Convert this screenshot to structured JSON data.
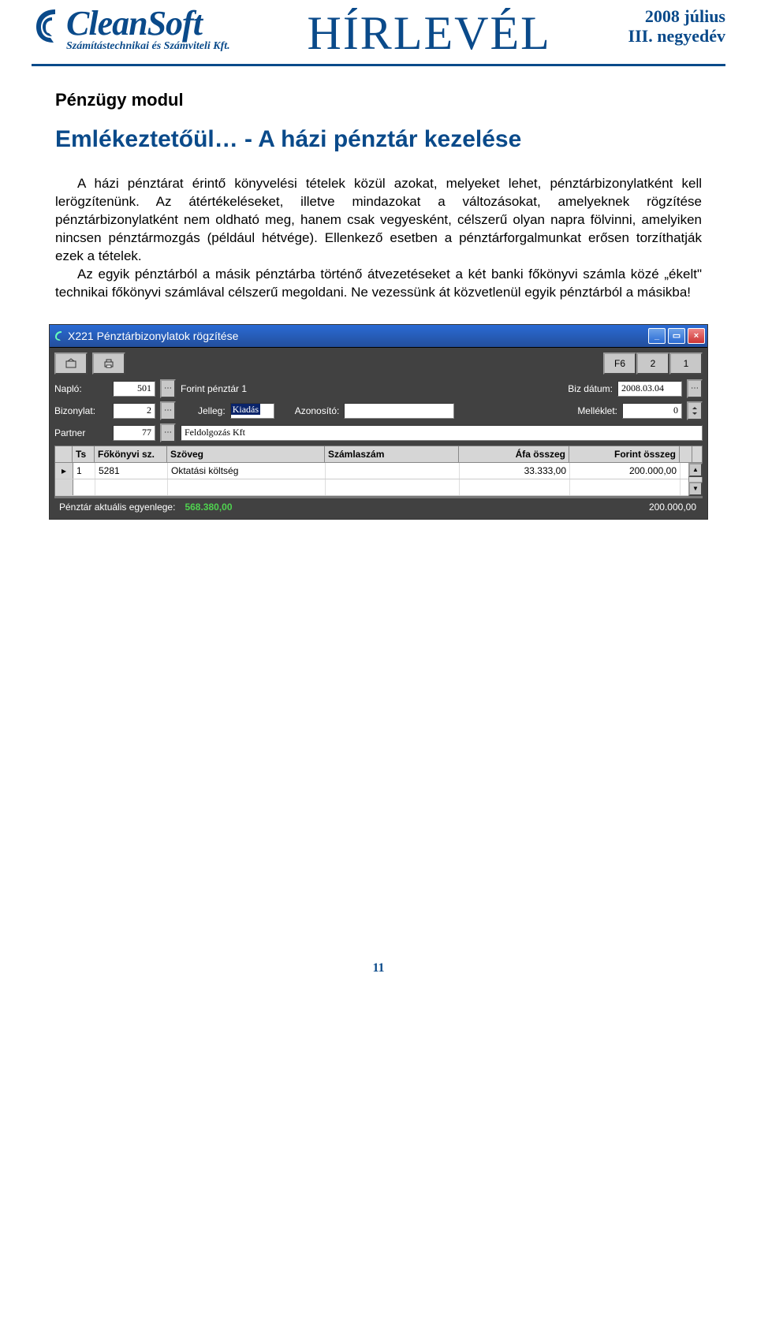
{
  "header": {
    "brand": "CleanSoft",
    "brand_sub": "Számítástechnikai és Számviteli Kft.",
    "headline": "HÍRLEVÉL",
    "issue_line1": "2008 július",
    "issue_line2": "III. negyedév"
  },
  "article": {
    "module": "Pénzügy modul",
    "title": "Emlékeztetőül… - A házi pénztár kezelése",
    "p1": "A házi pénztárat érintő könyvelési tételek közül azokat, melyeket lehet, pénztárbizonylatként kell lerögzítenünk. Az átértékeléseket, illetve mindazokat a változásokat, amelyeknek rögzítése pénztárbizonylatként nem oldható meg, hanem csak vegyesként, célszerű olyan napra fölvinni, amelyiken nincsen pénztármozgás (például hétvége). Ellenkező esetben a pénztárforgalmunkat erősen torzíthatják ezek a tételek.",
    "p2": "Az egyik pénztárból a másik pénztárba történő átvezetéseket a két banki főkönyvi számla közé „ékelt\" technikai főkönyvi számlával célszerű megoldani. Ne vezessünk át közvetlenül egyik pénztárból a másikba!"
  },
  "app": {
    "title": "X221 Pénztárbizonylatok rögzítése",
    "toolbar_right": [
      "F6",
      "2",
      "1"
    ],
    "labels": {
      "naplo": "Napló:",
      "biz_datum": "Biz dátum:",
      "bizonylat": "Bizonylat:",
      "jelleg": "Jelleg:",
      "azonosito": "Azonosító:",
      "melleklet": "Melléklet:",
      "partner": "Partner",
      "balance": "Pénztár aktuális egyenlege:"
    },
    "fields": {
      "naplo": "501",
      "naplo_name": "Forint pénztár 1",
      "biz_datum": "2008.03.04",
      "bizonylat": "2",
      "jelleg": "Kiadás",
      "azonosito": "",
      "melleklet": "0",
      "partner": "77",
      "partner_name": "Feldolgozás Kft"
    },
    "grid": {
      "headers": [
        "",
        "Ts",
        "Főkönyvi sz.",
        "Szöveg",
        "Számlaszám",
        "Áfa összeg",
        "Forint összeg"
      ],
      "rows": [
        {
          "ts": "1",
          "fokonyvi": "5281",
          "szoveg": "Oktatási költség",
          "szamlaszam": "",
          "afa": "33.333,00",
          "forint": "200.000,00"
        }
      ]
    },
    "balance": "568.380,00",
    "total": "200.000,00"
  },
  "page_number": "11"
}
